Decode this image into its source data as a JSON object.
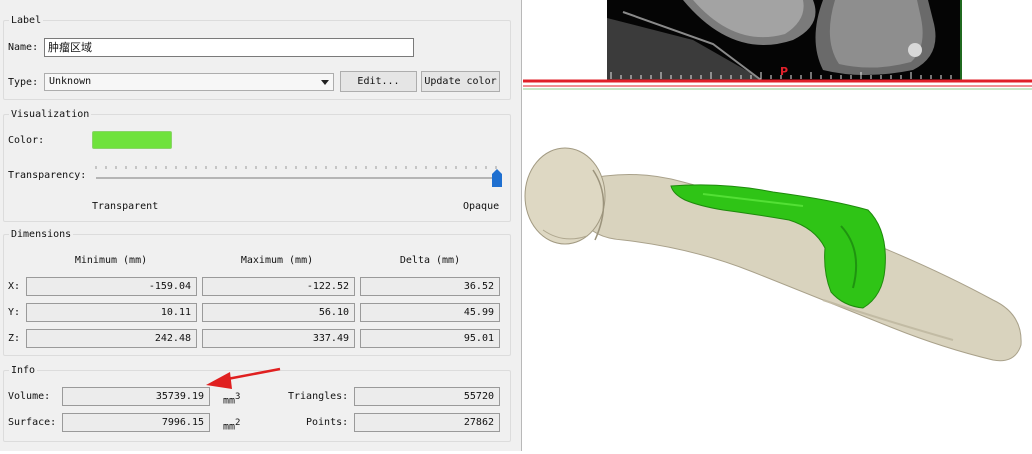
{
  "label_group": {
    "title": "Label",
    "name_label": "Name:",
    "name_value": "肿瘤区域",
    "type_label": "Type:",
    "type_value": "Unknown",
    "edit_button": "Edit...",
    "update_color_button": "Update color"
  },
  "visualization": {
    "title": "Visualization",
    "color_label": "Color:",
    "color_value": "#6fe23c",
    "transparency_label": "Transparency:",
    "transparency_level": 1.0,
    "slider_min_label": "Transparent",
    "slider_max_label": "Opaque",
    "slider_handle_color": "#1e6fd0"
  },
  "dimensions": {
    "title": "Dimensions",
    "headers": [
      "Minimum (mm)",
      "Maximum (mm)",
      "Delta (mm)"
    ],
    "rows": [
      {
        "axis": "X:",
        "min": "-159.04",
        "max": "-122.52",
        "delta": "36.52"
      },
      {
        "axis": "Y:",
        "min": "10.11",
        "max": "56.10",
        "delta": "45.99"
      },
      {
        "axis": "Z:",
        "min": "242.48",
        "max": "337.49",
        "delta": "95.01"
      }
    ]
  },
  "info": {
    "title": "Info",
    "volume_label": "Volume:",
    "volume_value": "35739.19",
    "volume_unit": "mm",
    "volume_exp": "3",
    "surface_label": "Surface:",
    "surface_value": "7996.15",
    "surface_unit": "mm",
    "surface_exp": "2",
    "triangles_label": "Triangles:",
    "triangles_value": "55720",
    "points_label": "Points:",
    "points_value": "27862"
  },
  "viewer": {
    "orientation_marker": "P",
    "bone_color": "#d8d2bd",
    "tumor_color": "#2fc416",
    "marker_color": "#e0202a"
  },
  "annotation": {
    "arrow_color": "#e02020"
  }
}
